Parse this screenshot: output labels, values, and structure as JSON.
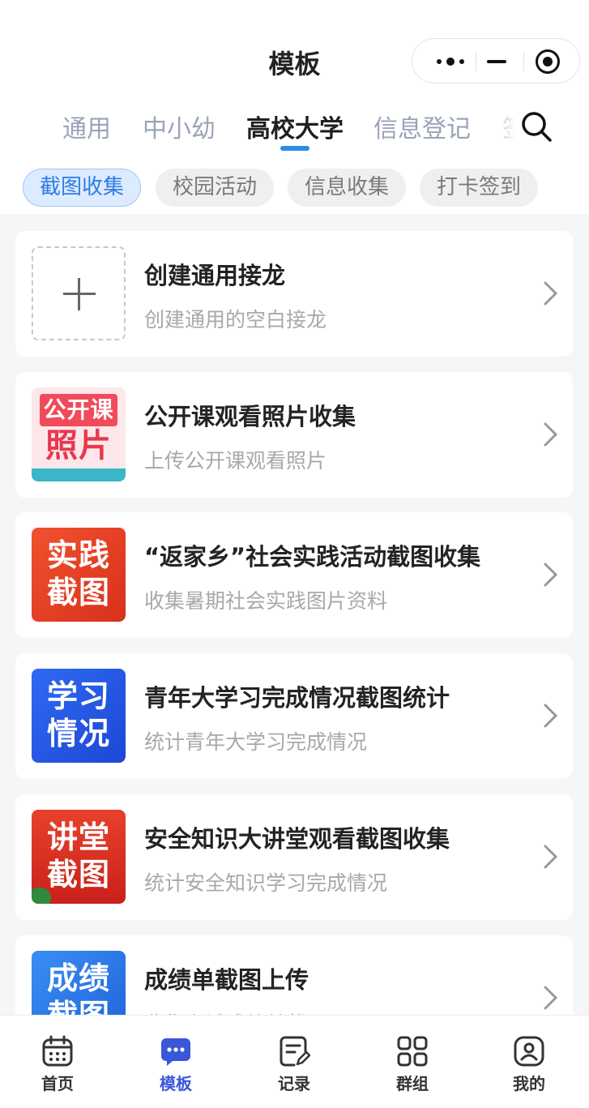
{
  "header": {
    "title": "模板",
    "capsule": {
      "more_icon": "more-dots-icon",
      "minimize_icon": "minimize-icon",
      "close_icon": "target-close-icon"
    }
  },
  "tabs": [
    {
      "label": "通用",
      "active": false
    },
    {
      "label": "中小幼",
      "active": false
    },
    {
      "label": "高校大学",
      "active": true
    },
    {
      "label": "信息登记",
      "active": false
    },
    {
      "label": "签",
      "active": false
    }
  ],
  "search": {
    "icon": "search-icon"
  },
  "chips": [
    {
      "label": "截图收集",
      "active": true
    },
    {
      "label": "校园活动",
      "active": false
    },
    {
      "label": "信息收集",
      "active": false
    },
    {
      "label": "打卡签到",
      "active": false
    }
  ],
  "cards": [
    {
      "title": "创建通用接龙",
      "subtitle": "创建通用的空白接龙",
      "thumb_lines": []
    },
    {
      "title": "公开课观看照片收集",
      "subtitle": "上传公开课观看照片",
      "thumb_lines": [
        "公开课",
        "照片"
      ]
    },
    {
      "title": "“返家乡”社会实践活动截图收集",
      "subtitle": "收集暑期社会实践图片资料",
      "thumb_lines": [
        "实践",
        "截图"
      ]
    },
    {
      "title": "青年大学习完成情况截图统计",
      "subtitle": "统计青年大学习完成情况",
      "thumb_lines": [
        "学习",
        "情况"
      ]
    },
    {
      "title": "安全知识大讲堂观看截图收集",
      "subtitle": "统计安全知识学习完成情况",
      "thumb_lines": [
        "讲堂",
        "截图"
      ]
    },
    {
      "title": "成绩单截图上传",
      "subtitle": "收集考试成绩单截图",
      "thumb_lines": [
        "成绩",
        "截图"
      ]
    }
  ],
  "tabbar": [
    {
      "label": "首页",
      "icon": "calendar-icon",
      "active": false
    },
    {
      "label": "模板",
      "icon": "chat-bubble-icon",
      "active": true
    },
    {
      "label": "记录",
      "icon": "edit-note-icon",
      "active": false
    },
    {
      "label": "群组",
      "icon": "grid-icon",
      "active": false
    },
    {
      "label": "我的",
      "icon": "user-icon",
      "active": false
    }
  ],
  "colors": {
    "accent": "#2f8dea",
    "tab_active": "#3a57d8",
    "chip_active_bg": "#dcebff",
    "chip_active_text": "#2f7de0"
  }
}
